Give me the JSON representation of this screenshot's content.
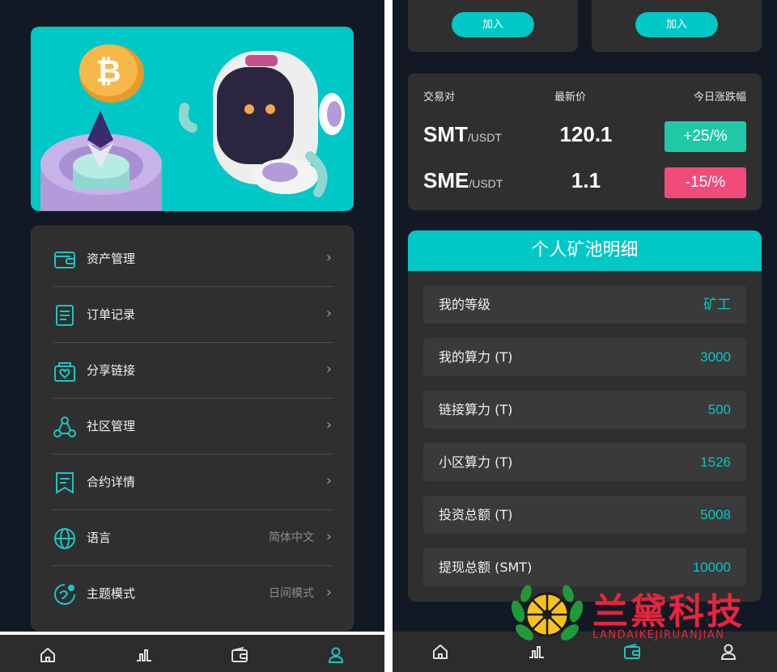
{
  "left": {
    "menu": [
      {
        "label": "资产管理",
        "value": "",
        "icon": "wallet-icon"
      },
      {
        "label": "订单记录",
        "value": "",
        "icon": "document-icon"
      },
      {
        "label": "分享链接",
        "value": "",
        "icon": "share-heart-icon"
      },
      {
        "label": "社区管理",
        "value": "",
        "icon": "community-icon"
      },
      {
        "label": "合约详情",
        "value": "",
        "icon": "contract-icon"
      },
      {
        "label": "语言",
        "value": "简体中文",
        "icon": "globe-icon"
      },
      {
        "label": "主题模式",
        "value": "日间模式",
        "icon": "theme-icon"
      }
    ],
    "chevron": "›",
    "tabs": [
      "home-icon",
      "chart-icon",
      "wallet-icon",
      "user-icon"
    ],
    "active_tab": "user-icon"
  },
  "right": {
    "join_buttons": [
      "加入",
      "加入"
    ],
    "pairs_header": {
      "pair": "交易对",
      "price": "最新价",
      "change": "今日涨跌幅"
    },
    "pairs": [
      {
        "base": "SMT",
        "quote": "/USDT",
        "price": "120.1",
        "change": "+25/%",
        "direction": "up"
      },
      {
        "base": "SME",
        "quote": "/USDT",
        "price": "1.1",
        "change": "-15/%",
        "direction": "down"
      }
    ],
    "pool": {
      "title": "个人矿池明细",
      "rows": [
        {
          "label": "我的等级",
          "value": "矿工"
        },
        {
          "label": "我的算力 (T)",
          "value": "3000"
        },
        {
          "label": "链接算力 (T)",
          "value": "500"
        },
        {
          "label": "小区算力 (T)",
          "value": "1526"
        },
        {
          "label": "投资总额 (T)",
          "value": "5008"
        },
        {
          "label": "提现总额 (SMT)",
          "value": "10000"
        }
      ]
    },
    "tabs": [
      "home-icon",
      "chart-icon",
      "wallet-icon",
      "user-icon"
    ],
    "active_tab": "wallet-icon"
  },
  "watermark": {
    "title": "兰黛科技",
    "subtitle": "LANDAIKEJIRUANJIAN"
  },
  "colors": {
    "accent": "#00c8c6",
    "up": "#1fc9a4",
    "down": "#f04b7a",
    "background": "#131924",
    "card": "#2f2f2f"
  }
}
